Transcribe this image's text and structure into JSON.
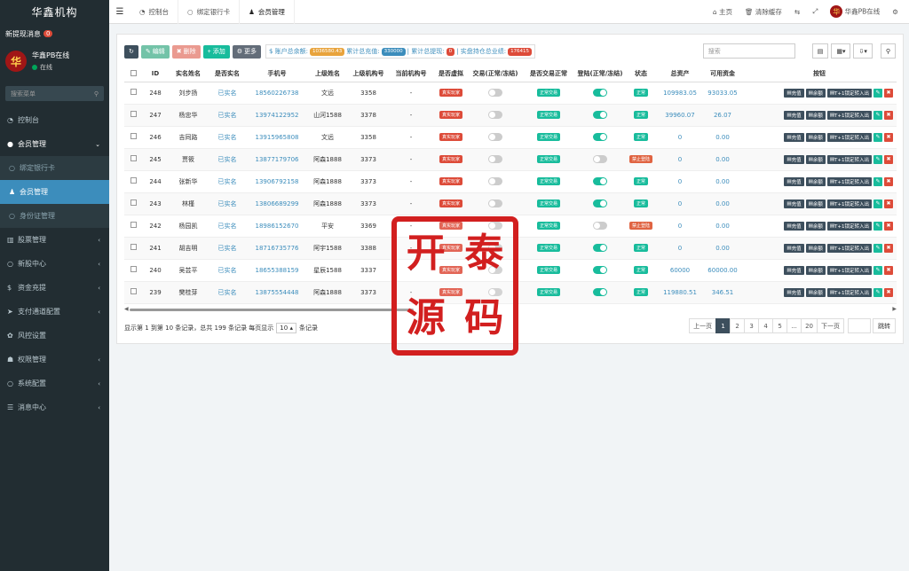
{
  "sidebar": {
    "brand": "华鑫机构",
    "new_msg_label": "新提现消息",
    "new_msg_count": "0",
    "avatar_text": "华",
    "user_name": "华鑫PB在线",
    "user_status": "在线",
    "search_placeholder": "搜索菜单",
    "items": [
      {
        "label": "控制台",
        "icon": "dashboard-icon"
      },
      {
        "label": "会员管理",
        "icon": "user-icon"
      },
      {
        "label": "绑定银行卡",
        "icon": "circle-icon"
      },
      {
        "label": "会员管理",
        "icon": "user-icon"
      },
      {
        "label": "身份证管理",
        "icon": "circle-icon"
      },
      {
        "label": "股票管理",
        "icon": "bank-icon"
      },
      {
        "label": "新股中心",
        "icon": "circle-icon"
      },
      {
        "label": "资金充提",
        "icon": "dollar-icon"
      },
      {
        "label": "支付通道配置",
        "icon": "arrow-icon"
      },
      {
        "label": "风控设置",
        "icon": "gear-icon"
      },
      {
        "label": "权限管理",
        "icon": "users-icon"
      },
      {
        "label": "系统配置",
        "icon": "circle-icon"
      },
      {
        "label": "消息中心",
        "icon": "list-icon"
      }
    ]
  },
  "topbar": {
    "tabs": [
      "控制台",
      "绑定银行卡",
      "会员管理"
    ],
    "home": "主页",
    "clear_cache": "清除缓存",
    "user": "华鑫PB在线"
  },
  "toolbar": {
    "edit": "编辑",
    "delete": "删除",
    "add": "添加",
    "more": "更多",
    "balance_label": "$ 账户总余额:",
    "balance_value": "1036580.43",
    "deposit_label": "累计总充值:",
    "deposit_value": "330000",
    "withdraw_label": "| 累计总提现:",
    "withdraw_value": "0",
    "hold_label": "| 实盘持仓总业绩:",
    "hold_value": "176415",
    "search_placeholder": "搜索"
  },
  "table": {
    "headers": [
      "ID",
      "实名姓名",
      "是否实名",
      "手机号",
      "上级姓名",
      "上级机构号",
      "当前机构号",
      "是否虚拟",
      "交易(正常/冻结)",
      "是否交易正常",
      "登陆(正常/冻结)",
      "状态",
      "总资产",
      "可用资金",
      "按钮"
    ],
    "rows": [
      {
        "id": "248",
        "name": "刘步扬",
        "verified": "已实名",
        "phone": "18560226738",
        "parent": "文远",
        "parent_code": "3358",
        "cur_code": "-",
        "virtual": "真实玩家",
        "trade_on": false,
        "trade_status": "正常交易",
        "login_on": true,
        "status": "正常",
        "status_type": "green",
        "assets": "109983.05",
        "available": "93033.05"
      },
      {
        "id": "247",
        "name": "杨忠华",
        "verified": "已实名",
        "phone": "13974122952",
        "parent": "山河1588",
        "parent_code": "3378",
        "cur_code": "-",
        "virtual": "真实玩家",
        "trade_on": false,
        "trade_status": "正常交易",
        "login_on": true,
        "status": "正常",
        "status_type": "green",
        "assets": "39960.07",
        "available": "26.07"
      },
      {
        "id": "246",
        "name": "吉同路",
        "verified": "已实名",
        "phone": "13915965808",
        "parent": "文远",
        "parent_code": "3358",
        "cur_code": "-",
        "virtual": "真实玩家",
        "trade_on": false,
        "trade_status": "正常交易",
        "login_on": true,
        "status": "正常",
        "status_type": "green",
        "assets": "0",
        "available": "0.00"
      },
      {
        "id": "245",
        "name": "贾筱",
        "verified": "已实名",
        "phone": "13877179706",
        "parent": "阿森1888",
        "parent_code": "3373",
        "cur_code": "-",
        "virtual": "真实玩家",
        "trade_on": false,
        "trade_status": "正常交易",
        "login_on": false,
        "status": "禁止登陆",
        "status_type": "red",
        "assets": "0",
        "available": "0.00"
      },
      {
        "id": "244",
        "name": "张新华",
        "verified": "已实名",
        "phone": "13906792158",
        "parent": "阿森1888",
        "parent_code": "3373",
        "cur_code": "-",
        "virtual": "真实玩家",
        "trade_on": false,
        "trade_status": "正常交易",
        "login_on": true,
        "status": "正常",
        "status_type": "green",
        "assets": "0",
        "available": "0.00"
      },
      {
        "id": "243",
        "name": "林槿",
        "verified": "已实名",
        "phone": "13806689299",
        "parent": "阿森1888",
        "parent_code": "3373",
        "cur_code": "-",
        "virtual": "真实玩家",
        "trade_on": false,
        "trade_status": "正常交易",
        "login_on": true,
        "status": "正常",
        "status_type": "green",
        "assets": "0",
        "available": "0.00"
      },
      {
        "id": "242",
        "name": "杨园凯",
        "verified": "已实名",
        "phone": "18986152670",
        "parent": "平安",
        "parent_code": "3369",
        "cur_code": "-",
        "virtual": "真实玩家",
        "trade_on": false,
        "trade_status": "正常交易",
        "login_on": false,
        "status": "禁止登陆",
        "status_type": "red",
        "assets": "0",
        "available": "0.00"
      },
      {
        "id": "241",
        "name": "胡吉明",
        "verified": "已实名",
        "phone": "18716735776",
        "parent": "阿宇1588",
        "parent_code": "3388",
        "cur_code": "-",
        "virtual": "真实玩家",
        "trade_on": false,
        "trade_status": "正常交易",
        "login_on": true,
        "status": "正常",
        "status_type": "green",
        "assets": "0",
        "available": "0.00"
      },
      {
        "id": "240",
        "name": "吴芸平",
        "verified": "已实名",
        "phone": "18655388159",
        "parent": "星辰1588",
        "parent_code": "3337",
        "cur_code": "-",
        "virtual": "真实玩家",
        "trade_on": false,
        "trade_status": "正常交易",
        "login_on": true,
        "status": "正常",
        "status_type": "green",
        "assets": "60000",
        "available": "60000.00"
      },
      {
        "id": "239",
        "name": "樊桂芽",
        "verified": "已实名",
        "phone": "13875554448",
        "parent": "阿森1888",
        "parent_code": "3373",
        "cur_code": "-",
        "virtual": "真实玩家",
        "trade_on": false,
        "trade_status": "正常交易",
        "login_on": true,
        "status": "正常",
        "status_type": "green",
        "assets": "119880.51",
        "available": "346.51"
      }
    ],
    "row_buttons": [
      "充值",
      "余额",
      "T+1锁定转入出"
    ]
  },
  "footer": {
    "info_prefix": "显示第 1 到第 10 条记录，总共 199 条记录 每页显示",
    "page_size": "10",
    "info_suffix": "条记录",
    "prev": "上一页",
    "next": "下一页",
    "pages": [
      "1",
      "2",
      "3",
      "4",
      "5",
      "...",
      "20"
    ],
    "jump": "跳转"
  },
  "stamp": [
    "开",
    "泰",
    "源",
    "码"
  ],
  "colors": {
    "sidebar": "#222d32",
    "accent": "#3c8dbc",
    "green": "#18bc9c",
    "red": "#dd4b39"
  }
}
